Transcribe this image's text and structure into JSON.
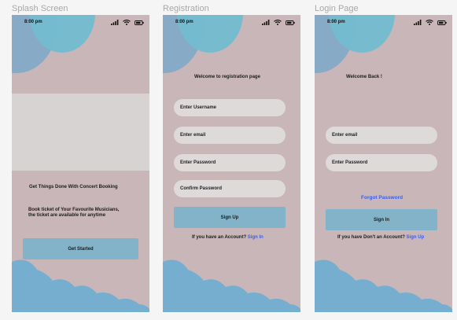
{
  "frames": {
    "splash": {
      "label": "Splash Screen",
      "time": "8:00 pm",
      "headline": "Get Things Done With Concert Booking",
      "desc_line1": "Book ticket of Your Favourite Musicians,",
      "desc_line2": "the ticket are available for anytime",
      "cta": "Get Started"
    },
    "register": {
      "label": "Registration",
      "time": "8:00 pm",
      "title": "Welcome to registration page",
      "username": "Enter Username",
      "email": "Enter email",
      "password": "Enter Password",
      "confirm": "Confirm Password",
      "signup": "Sign Up",
      "account_q": "If you have an Account?",
      "signin_link": "Sign In"
    },
    "login": {
      "label": "Login Page",
      "time": "8:00 pm",
      "title": "Welcome Back !",
      "email": "Enter email",
      "password": "Enter Password",
      "forgot": "Forgot Password",
      "signin": "Sign In",
      "account_q": "If you have Don't an Account?",
      "signup_link": "Sign Up"
    }
  },
  "colors": {
    "frame_bg": "#c9b6b8",
    "blue_blob": "#73bcd0",
    "purple_blob": "#7fa8c9",
    "button": "#83b3c9",
    "field": "#dedada",
    "link": "#3c5fe0"
  }
}
